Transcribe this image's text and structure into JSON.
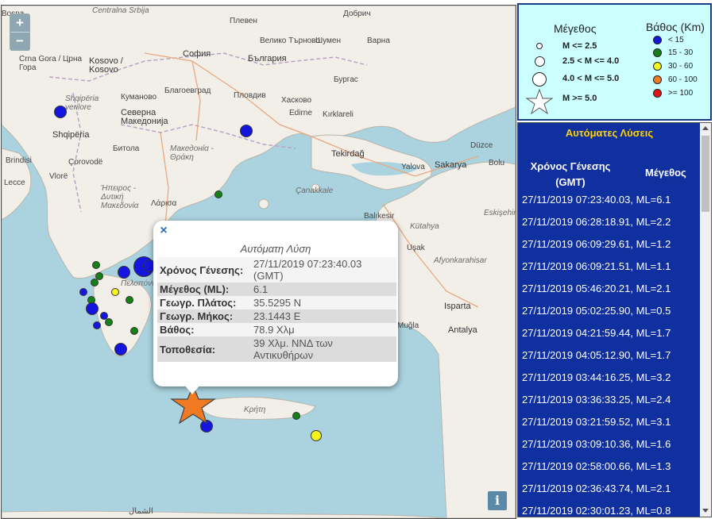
{
  "map": {
    "zoom_in": "+",
    "zoom_out": "−",
    "info_label": "i",
    "labels": [
      "Добрич",
      "Плевен",
      "Шумен",
      "Centralna Srbija",
      "Варна",
      "Велико Търново",
      "Bosna",
      "София",
      "България",
      "Бургас",
      "Crna Gora / Црна Гора",
      "Kosovo / Kosovo",
      "Благоевград",
      "Пловдив",
      "Хасково",
      "Кумановo",
      "Северна Македонија",
      "Edirne",
      "Kırklareli",
      "Shqipëria verilore",
      "Битола",
      "Македонία - Θράκη",
      "Shqipëria",
      "Tekirdağ",
      "Düzce",
      "Brindisi",
      "Çorovodë",
      "Yalova",
      "Sakarya",
      "Bolu",
      "Vlorë",
      "Ήπειρος - Δυτική Μακεδονία",
      "Çanakkale",
      "Lecce",
      "Λάρισα",
      "Balıkesir",
      "Kütahya",
      "Eskişehir",
      "Uşak",
      "Afyonkarahisar",
      "Πελοπόννησος",
      "Isparta",
      "Antalya",
      "Muğla",
      "Κρήτη",
      "الشمال"
    ],
    "quakes": [
      {
        "lat": 42.6,
        "lon": 19.3,
        "depth_class": "< 15",
        "mag_class": "2.5 < M <= 4.0"
      },
      {
        "lat": 41.2,
        "lon": 24.8,
        "depth_class": "< 15",
        "mag_class": "2.5 < M <= 4.0"
      },
      {
        "lat": 40.2,
        "lon": 24.6,
        "depth_class": "15 - 30",
        "mag_class": "M <= 2.5"
      },
      {
        "lat": 38.9,
        "lon": 21.1,
        "depth_class": "< 15",
        "mag_class": "4.0 < M <= 5.0"
      },
      {
        "lat": 38.3,
        "lon": 20.3,
        "depth_class": "< 15",
        "mag_class": "2.5 < M <= 4.0"
      },
      {
        "lat": 38.1,
        "lon": 20.9,
        "depth_class": "30 - 60",
        "mag_class": "M <= 2.5"
      },
      {
        "lat": 37.6,
        "lon": 21.2,
        "depth_class": "< 15",
        "mag_class": "2.5 < M <= 4.0"
      },
      {
        "lat": 36.4,
        "lon": 25.4,
        "depth_class": "30 - 60",
        "mag_class": "2.5 < M <= 4.0"
      },
      {
        "lat": 35.3,
        "lon": 23.5,
        "depth_class": "< 15",
        "mag_class": "2.5 < M <= 4.0"
      },
      {
        "lat": 35.5,
        "lon": 25.0,
        "depth_class": "15 - 30",
        "mag_class": "M <= 2.5"
      }
    ],
    "main_event": {
      "lat": 35.5295,
      "lon": 23.1443,
      "color": "#f07a21",
      "mag_class": "M >= 5.0"
    }
  },
  "popup": {
    "close": "×",
    "title": "Αυτόματη Λύση",
    "rows": [
      {
        "label": "Χρόνος Γένεσης:",
        "value": "27/11/2019 07:23:40.03 (GMT)"
      },
      {
        "label": "Μέγεθος (ML):",
        "value": "6.1"
      },
      {
        "label": "Γεωγρ. Πλάτος:",
        "value": "35.5295 N"
      },
      {
        "label": "Γεωγρ. Μήκος:",
        "value": "23.1443 E"
      },
      {
        "label": "Βάθος:",
        "value": "78.9 Χλμ"
      },
      {
        "label": "Τοποθεσία:",
        "value": "39 Χλμ. ΝΝΔ των Αντικυθήρων"
      }
    ]
  },
  "legend": {
    "magnitude_title": "Μέγεθος",
    "depth_title": "Βάθος (Km)",
    "magnitude_items": [
      "M <= 2.5",
      "2.5 < M <= 4.0",
      "4.0 < M <= 5.0",
      "M >= 5.0"
    ],
    "depth_items": [
      {
        "label": "< 15",
        "color": "#1515e0"
      },
      {
        "label": "15 - 30",
        "color": "#158015"
      },
      {
        "label": "30 - 60",
        "color": "#f5f51a"
      },
      {
        "label": "60 - 100",
        "color": "#f07a21"
      },
      {
        "label": ">= 100",
        "color": "#e01515"
      }
    ]
  },
  "list": {
    "title": "Αυτόματες Λύσεις",
    "col_time": "Χρόνος Γένεσης (GMT)",
    "col_mag": "Μέγεθος",
    "rows": [
      "27/11/2019 07:23:40.03, ML=6.1",
      "27/11/2019 06:28:18.91, ML=2.2",
      "27/11/2019 06:09:29.61, ML=1.2",
      "27/11/2019 06:09:21.51, ML=1.1",
      "27/11/2019 05:46:20.21, ML=2.1",
      "27/11/2019 05:02:25.90, ML=0.5",
      "27/11/2019 04:21:59.44, ML=1.7",
      "27/11/2019 04:05:12.90, ML=1.7",
      "27/11/2019 03:44:16.25, ML=3.2",
      "27/11/2019 03:36:33.25, ML=2.4",
      "27/11/2019 03:21:59.52, ML=3.1",
      "27/11/2019 03:09:10.36, ML=1.6",
      "27/11/2019 02:58:00.66, ML=1.3",
      "27/11/2019 02:36:43.74, ML=2.1",
      "27/11/2019 02:30:01.23, ML=0.8"
    ]
  }
}
